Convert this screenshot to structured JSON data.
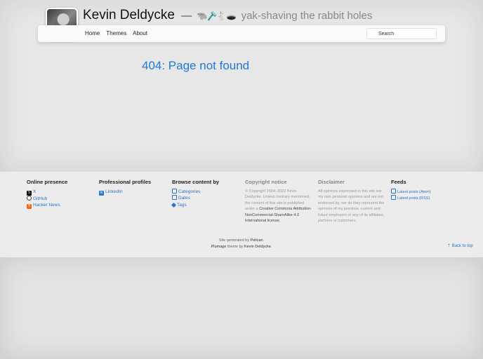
{
  "header": {
    "title": "Kevin Deldycke",
    "dash": "—",
    "emoji": "🐃🪒🐇🕳️",
    "tagline": "yak-shaving the rabbit holes"
  },
  "nav": {
    "items": [
      "Home",
      "Themes",
      "About"
    ],
    "search_placeholder": "Search"
  },
  "main": {
    "heading": "404: Page not found"
  },
  "footer": {
    "online": {
      "title": "Online presence",
      "links": [
        "X",
        "GitHub",
        "Hacker News"
      ]
    },
    "professional": {
      "title": "Professional profiles",
      "links": [
        "LinkedIn"
      ]
    },
    "browse": {
      "title": "Browse content by",
      "links": [
        "Categories",
        "Dates",
        "Tags"
      ]
    },
    "copyright": {
      "title": "Copyright notice",
      "text1": "© Copyright 2004–2022 Kevin Deldycke. Unless contrary mentioned, the content of this site is published under a",
      "text2": "Creative Commons Attribution-NonCommercial-ShareAlike 4.0 International license",
      "text3": "."
    },
    "disclaimer": {
      "title": "Disclaimer",
      "text": "All opinions expressed in this site are my own personal opinions and are not endorsed by, nor do they represent the opinions of my previous, current and future employers or any of its affiliates, partners or customers."
    },
    "feeds": {
      "title": "Feeds",
      "links": [
        "Latest posts (Atom)",
        "Latest posts (RSS)"
      ]
    },
    "generated": {
      "line1_prefix": "Site generated by",
      "line1_link": "Pelican",
      "line1_suffix": ".",
      "line2_link1": "Plumage",
      "line2_middle": "theme by",
      "line2_link2": "Kevin Deldycke",
      "line2_suffix": "."
    },
    "back_to_top": "⇡ Back to top"
  }
}
